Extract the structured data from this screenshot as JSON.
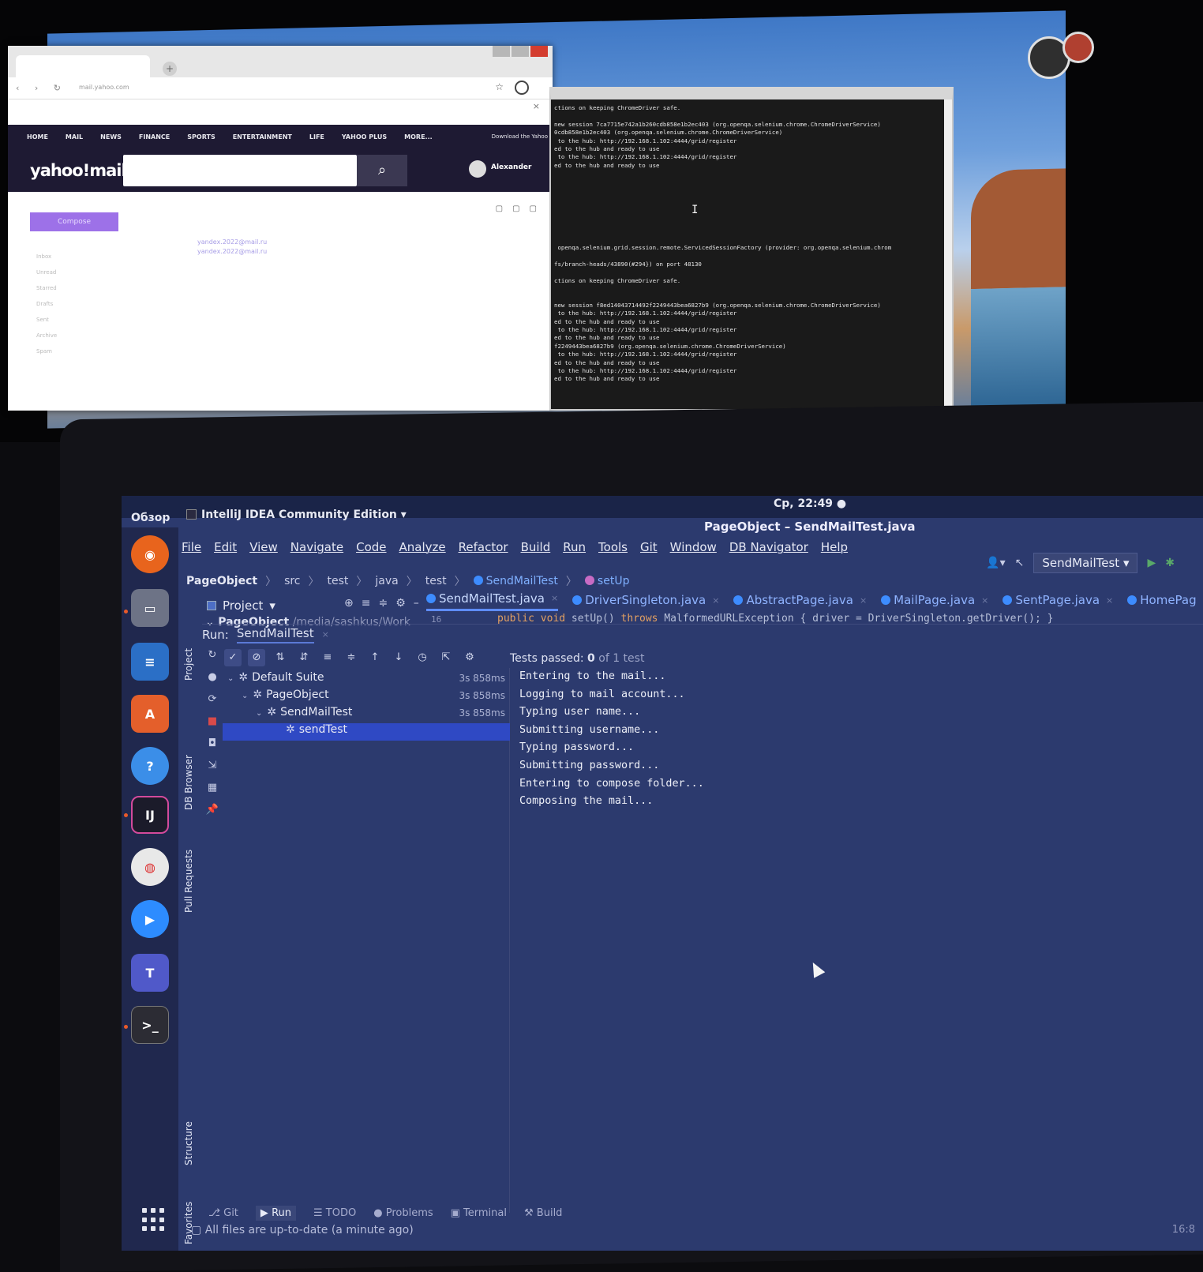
{
  "back_monitor": {
    "browser": {
      "tab_title": "",
      "url": "mail.yahoo.com",
      "info_text": "",
      "yahoo_nav": [
        "HOME",
        "MAIL",
        "NEWS",
        "FINANCE",
        "SPORTS",
        "ENTERTAINMENT",
        "LIFE",
        "YAHOO PLUS",
        "MORE..."
      ],
      "download_text": "Download the Yahoo",
      "logo": "yahoo!mail",
      "search_placeholder": "",
      "user_name": "Alexander",
      "compose_label": "Compose",
      "folders": [
        "Inbox",
        "Unread",
        "Starred",
        "Drafts",
        "Sent",
        "Archive",
        "Spam"
      ],
      "mail_lines": [
        "yandex.2022@mail.ru",
        "yandex.2022@mail.ru"
      ]
    },
    "terminal": {
      "lines": [
        "ctions on keeping ChromeDriver safe.",
        "",
        "new session 7ca7715e742a1b260cdb858e1b2ec403 (org.openqa.selenium.chrome.ChromeDriverService)",
        "0cdb858e1b2ec403 (org.openqa.selenium.chrome.ChromeDriverService)",
        " to the hub: http://192.168.1.102:4444/grid/register",
        "ed to the hub and ready to use",
        " to the hub: http://192.168.1.102:4444/grid/register",
        "ed to the hub and ready to use",
        "",
        "",
        "",
        "",
        "",
        "",
        "",
        "",
        "",
        " openqa.selenium.grid.session.remote.ServicedSessionFactory (provider: org.openqa.selenium.chrom",
        "",
        "fs/branch-heads/43890(#294}) on port 48130",
        "",
        "ctions on keeping ChromeDriver safe.",
        "",
        "",
        "new session f8ed14043714492f2249443bea6827b9 (org.openqa.selenium.chrome.ChromeDriverService)",
        " to the hub: http://192.168.1.102:4444/grid/register",
        "ed to the hub and ready to use",
        " to the hub: http://192.168.1.102:4444/grid/register",
        "ed to the hub and ready to use",
        "f2249443bea6827b9 (org.openqa.selenium.chrome.ChromeDriverService)",
        " to the hub: http://192.168.1.102:4444/grid/register",
        "ed to the hub and ready to use",
        " to the hub: http://192.168.1.102:4444/grid/register",
        "ed to the hub and ready to use"
      ]
    }
  },
  "gnome": {
    "activities": "Обзор",
    "app_menu": "IntelliJ IDEA Community Edition",
    "clock": "Ср, 22:49 ●"
  },
  "dock": {
    "items": [
      "firefox",
      "files",
      "writer",
      "software",
      "help",
      "intellij",
      "chrome",
      "zoom",
      "teams",
      "terminal"
    ],
    "colors": {
      "firefox": "#e8641d",
      "files": "#6d7386",
      "writer": "#2b6fc6",
      "software": "#e45f2b",
      "help": "#3b8ee8",
      "intellij": "#1b1b2a",
      "chrome": "#e8e8e8",
      "zoom": "#2d8cff",
      "teams": "#5059c9",
      "terminal": "#2c2c34"
    }
  },
  "ide": {
    "window_title": "PageObject – SendMailTest.java",
    "menu": [
      "File",
      "Edit",
      "View",
      "Navigate",
      "Code",
      "Analyze",
      "Refactor",
      "Build",
      "Run",
      "Tools",
      "Git",
      "Window",
      "DB Navigator",
      "Help"
    ],
    "run_config": "SendMailTest",
    "breadcrumb": {
      "root": "PageObject",
      "parts": [
        "src",
        "test",
        "java",
        "test"
      ],
      "class": "SendMailTest",
      "method": "setUp"
    },
    "project_label": "Project",
    "project_root": "PageObject",
    "project_path": "/media/sashkus/Work",
    "line_number": "16",
    "code": {
      "kw1": "public void",
      "name": " setUp() ",
      "kw2": "throws",
      "rest": " MalformedURLException { driver = DriverSingleton.getDriver(); }"
    },
    "editor_tabs": [
      "SendMailTest.java",
      "DriverSingleton.java",
      "AbstractPage.java",
      "MailPage.java",
      "SentPage.java",
      "HomePag"
    ],
    "left_strip_labels": [
      "Project",
      "DB Browser",
      "Pull Requests",
      "Structure",
      "Favorites"
    ],
    "run": {
      "label": "Run:",
      "tab": "SendMailTest",
      "status_prefix": "Tests passed: ",
      "status_count": "0",
      "status_suffix": " of 1 test",
      "tree": [
        {
          "name": "Default Suite",
          "time": "3s 858ms"
        },
        {
          "name": "PageObject",
          "time": "3s 858ms"
        },
        {
          "name": "SendMailTest",
          "time": "3s 858ms"
        },
        {
          "name": "sendTest",
          "time": ""
        }
      ],
      "console": [
        "Entering to the mail...",
        "Logging to mail account...",
        "Typing user name...",
        "Submitting username...",
        "Typing password...",
        "Submitting password...",
        "Entering to compose folder...",
        "Composing the mail..."
      ]
    },
    "bottom_tabs": [
      "Git",
      "Run",
      "TODO",
      "Problems",
      "Terminal",
      "Build"
    ],
    "status_text": "All files are up-to-date (a minute ago)",
    "status_clock": "16:8"
  }
}
